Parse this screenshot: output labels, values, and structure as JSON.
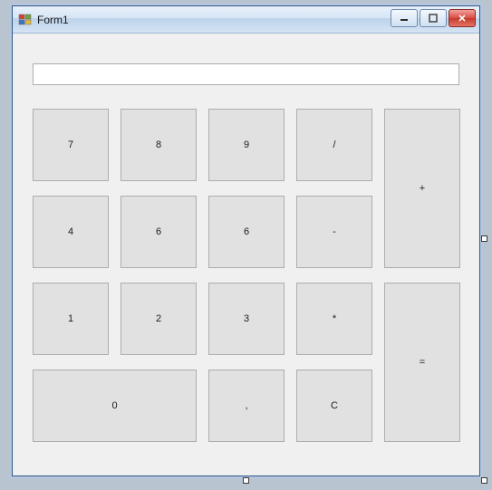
{
  "window": {
    "title": "Form1"
  },
  "display": {
    "value": ""
  },
  "buttons": {
    "b7": "7",
    "b8": "8",
    "b9": "9",
    "bdiv": "/",
    "bplus": "+",
    "b4": "4",
    "b6a": "6",
    "b6b": "6",
    "bminus": "-",
    "b1": "1",
    "b2": "2",
    "b3": "3",
    "bmul": "*",
    "beq": "=",
    "b0": "0",
    "bcomma": ",",
    "bclear": "C"
  }
}
